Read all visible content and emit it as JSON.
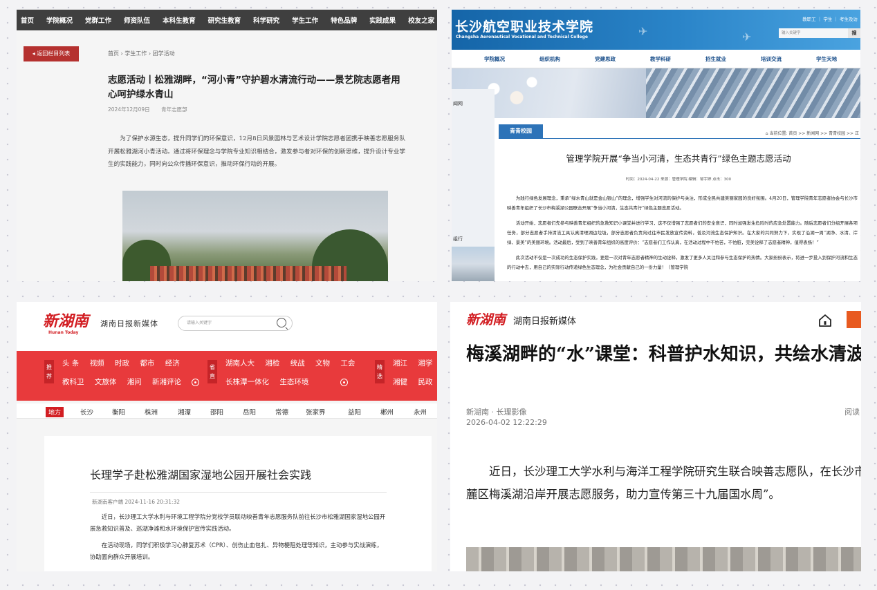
{
  "p1": {
    "nav": [
      "首页",
      "学院概况",
      "党群工作",
      "师资队伍",
      "本科生教育",
      "研究生教育",
      "科学研究",
      "学生工作",
      "特色品牌",
      "实践成果",
      "校友之家"
    ],
    "back_label": "返回栏目列表",
    "breadcrumb": "首页 › 学生工作 › 团学活动",
    "title": "志愿活动丨松雅湖畔，“河小青”守护碧水清流行动——景艺院志愿者用心呵护绿水青山",
    "date": "2024年12月09日",
    "category": "青年志愿部",
    "body": "为了保护水源生态，提升同学们的环保意识，12月8日风景园林与艺术设计学院志愿者团携手映善志愿服务队开展松雅湖河小青活动。通过将环保理念与学院专业知识相结合，激发参与者对环保的创新思维，提升设计专业学生的实践能力，同时向公众传播环保意识，推动环保行动的开展。"
  },
  "p2": {
    "logo": "长沙航空职业技术学院",
    "logo_en": "Changsha Aeronautical Vocational and Technical College",
    "toplinks": "教职工 ｜ 学生 ｜ 考生及访",
    "search_placeholder": "输入关键字",
    "search_btn": "搜",
    "nav": [
      "学院概况",
      "组织机构",
      "党建思政",
      "教学科研",
      "招生就业",
      "培训交流",
      "学生天地"
    ],
    "side_label_1": "闻网",
    "side_label_2": "组行",
    "tab": "青青校园",
    "location": "当前位置: 首页 >> 新闻网 >> 青青校园 >> 正",
    "title": "管理学院开展“争当小河清，生态共青行”绿色主题志愿活动",
    "meta": "时间：2024-04-22  来源：管理学院  编辑：邹宇婷  点击：300",
    "paragraphs": [
      "为践行绿色发展理念，秉承“绿水青山就是金山银山”的理念，增强学生对河流的保护与关注，形成全民共建美丽家园的良好氛围。4月20日，管理学院青年志愿者协会与长沙市映善青年组织了长沙市梅溪湖公园联合开展“争当小河清，生态共青行”绿色主题志愿活动。",
      "活动开始，志愿者们先参与映善青年组织的急救知识小课堂并进行学习，这不仅增强了志愿者们的安全意识，同时加强发生危险时的应急处置能力。随后志愿者们分组开展各项任务，部分志愿者手持清洁工具认真清理湖边垃圾，部分志愿者负责向过往市民发放宣传资料，普及河流生态保护知识。在大家的共同努力下，实现了沿湖一周“湖净、水清、岸绿、景美”的美丽环境。活动最后，受到了映善青年组织的高度评价：“志愿者们工作认真，在活动过程中不怕苦，不怕脏，完美诠释了志愿者精神，值得表扬！”",
      "此次活动不仅是一次成功的生态保护实践，更是一次对青年志愿者精神的生动诠释，激发了更多人关注和参与生态保护的热情。大家纷纷表示，将进一步投入到保护河流和生态的行动中去，用自己的实际行动传递绿色生态理念，为社会贡献自己的一份力量！（管理学院"
    ]
  },
  "p3": {
    "logo": "新湖南",
    "logo_sub": "Hunan Today",
    "brand": "湖南日报新媒体",
    "search_placeholder": "请输入关键字",
    "tags": [
      "推荐",
      "省直",
      "精选"
    ],
    "row1a": [
      "头 条",
      "视频",
      "时政",
      "都市",
      "经济"
    ],
    "row2a": [
      "教科卫",
      "文旅体",
      "湘问",
      "新湘评论"
    ],
    "row1b": [
      "湖南人大",
      "湘检",
      "统战",
      "文物",
      "工会"
    ],
    "row2b": [
      "长株潭一体化",
      "生态环境"
    ],
    "row1c": [
      "湘江",
      "湘学"
    ],
    "row2c": [
      "湘健",
      "民政"
    ],
    "region_lead": "地方",
    "cities": [
      "长沙",
      "衡阳",
      "株洲",
      "湘潭",
      "邵阳",
      "岳阳",
      "常德",
      "张家界",
      "益阳",
      "郴州",
      "永州"
    ],
    "title": "长理学子赴松雅湖国家湿地公园开展社会实践",
    "meta": "新湖南客户端   2024-11-16 20:31:32",
    "paragraphs": [
      "近日，长沙理工大学水利与环境工程学院分党校学员联动映善青年志愿服务队前往长沙市松雅湖国家湿地公园开展急救知识普及、巡湖净滩和水环境保护宣传实践活动。",
      "在活动现场，同学们积极学习心肺复苏术（CPR）、创伤止血包扎、异物梗阻处理等知识，主动参与实战演练，协助面向群众开展培训。"
    ]
  },
  "p4": {
    "logo": "新湖南",
    "brand": "湖南日报新媒体",
    "title": "梅溪湖畔的“水”课堂：科普护水知识，共绘水清波",
    "source": "新湖南 · 长理影像",
    "read": "阅读",
    "time": "2026-04-02 12:22:29",
    "body": "近日，长沙理工大学水利与海洋工程学院研究生联合映善志愿队，在长沙市岳麓区梅溪湖沿岸开展志愿服务，助力宣传第三十九届国水周”。"
  }
}
